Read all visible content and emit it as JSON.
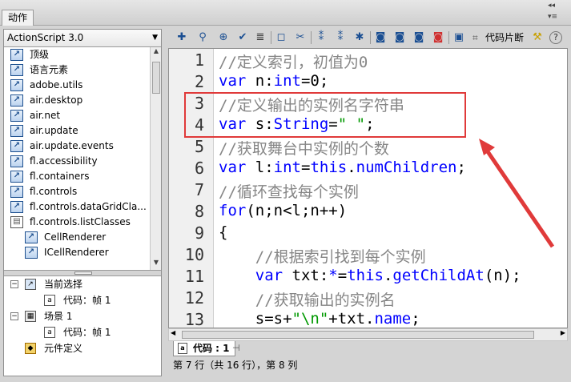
{
  "window": {
    "tab_label": "动作",
    "ctrl_collapse": "◂◂",
    "ctrl_menu": "▾≡"
  },
  "library": {
    "selected": "ActionScript 3.0",
    "items": [
      {
        "label": "顶级",
        "icon": "book-icon"
      },
      {
        "label": "语言元素",
        "icon": "book-icon"
      },
      {
        "label": "adobe.utils",
        "icon": "book-icon"
      },
      {
        "label": "air.desktop",
        "icon": "book-icon"
      },
      {
        "label": "air.net",
        "icon": "book-icon"
      },
      {
        "label": "air.update",
        "icon": "book-icon"
      },
      {
        "label": "air.update.events",
        "icon": "book-icon"
      },
      {
        "label": "fl.accessibility",
        "icon": "book-icon"
      },
      {
        "label": "fl.containers",
        "icon": "book-icon"
      },
      {
        "label": "fl.controls",
        "icon": "book-icon"
      },
      {
        "label": "fl.controls.dataGridCla...",
        "icon": "book-icon"
      },
      {
        "label": "fl.controls.listClasses",
        "icon": "open-book-icon"
      },
      {
        "label": "CellRenderer",
        "icon": "book-icon",
        "sub": true
      },
      {
        "label": "ICellRenderer",
        "icon": "book-icon",
        "sub": true
      }
    ]
  },
  "tree": {
    "current_selection": "当前选择",
    "current_frame": "代码：帧 1",
    "scene": "场景 1",
    "scene_frame": "代码：帧 1",
    "symbol_defs": "元件定义"
  },
  "toolbar": {
    "snippets_label": "代码片断",
    "help": "?"
  },
  "editor": {
    "line_numbers": [
      "1",
      "2",
      "3",
      "4",
      "5",
      "6",
      "7",
      "8",
      "9",
      "10",
      "11",
      "12",
      "13"
    ],
    "lines": [
      [
        {
          "t": "//定义索引，初值为0",
          "c": "comment"
        }
      ],
      [
        {
          "t": "var",
          "c": "kw"
        },
        {
          "t": " n:",
          "c": "plain"
        },
        {
          "t": "int",
          "c": "ty"
        },
        {
          "t": "=0;",
          "c": "plain"
        }
      ],
      [
        {
          "t": "//定义输出的实例名字符串",
          "c": "comment"
        }
      ],
      [
        {
          "t": "var",
          "c": "kw"
        },
        {
          "t": " s:",
          "c": "plain"
        },
        {
          "t": "String",
          "c": "ty"
        },
        {
          "t": "=",
          "c": "plain"
        },
        {
          "t": "\" \"",
          "c": "str"
        },
        {
          "t": ";",
          "c": "plain"
        }
      ],
      [
        {
          "t": "//获取舞台中实例的个数",
          "c": "comment"
        }
      ],
      [
        {
          "t": "var",
          "c": "kw"
        },
        {
          "t": " l:",
          "c": "plain"
        },
        {
          "t": "int",
          "c": "ty"
        },
        {
          "t": "=",
          "c": "plain"
        },
        {
          "t": "this",
          "c": "kw"
        },
        {
          "t": ".",
          "c": "plain"
        },
        {
          "t": "numChildren",
          "c": "kw"
        },
        {
          "t": ";",
          "c": "plain"
        }
      ],
      [
        {
          "t": "//循环查找每个实例",
          "c": "comment"
        }
      ],
      [
        {
          "t": "for",
          "c": "kw"
        },
        {
          "t": "(n;n<l;n++)",
          "c": "plain"
        }
      ],
      [
        {
          "t": "{",
          "c": "plain"
        }
      ],
      [
        {
          "t": "    //根据索引找到每个实例",
          "c": "comment"
        }
      ],
      [
        {
          "t": "    ",
          "c": "plain"
        },
        {
          "t": "var",
          "c": "kw"
        },
        {
          "t": " txt:",
          "c": "plain"
        },
        {
          "t": "*",
          "c": "ty"
        },
        {
          "t": "=",
          "c": "plain"
        },
        {
          "t": "this",
          "c": "kw"
        },
        {
          "t": ".",
          "c": "plain"
        },
        {
          "t": "getChildAt",
          "c": "kw"
        },
        {
          "t": "(n);",
          "c": "plain"
        }
      ],
      [
        {
          "t": "    //获取输出的实例名",
          "c": "comment"
        }
      ],
      [
        {
          "t": "    s=s+",
          "c": "plain"
        },
        {
          "t": "\"\\n\"",
          "c": "str"
        },
        {
          "t": "+txt.",
          "c": "plain"
        },
        {
          "t": "name",
          "c": "kw"
        },
        {
          "t": ";",
          "c": "plain"
        }
      ]
    ]
  },
  "code_tab": {
    "label": "代码 : 1"
  },
  "status": {
    "text": "第 7 行（共 16 行），第 8 列"
  },
  "colors": {
    "highlight": "#e03a3a",
    "keyword": "#0000ff",
    "comment": "#868686",
    "string": "#009900"
  }
}
